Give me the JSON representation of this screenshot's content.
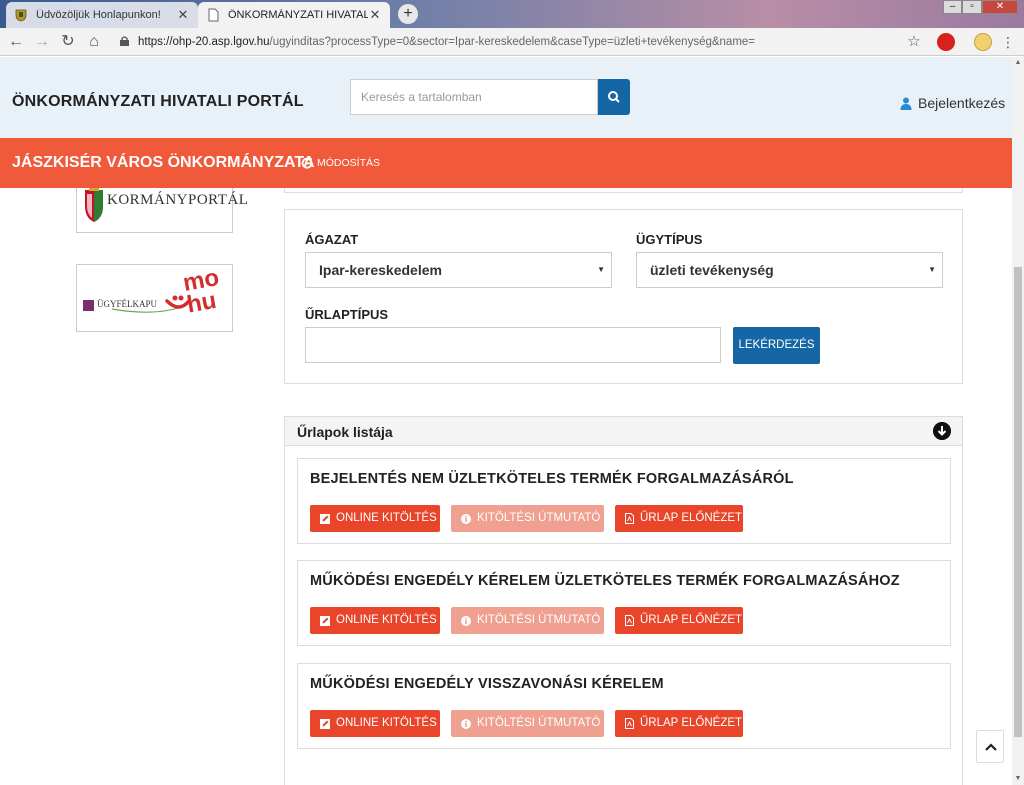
{
  "browser": {
    "tabs": [
      {
        "title": "Üdvözöljük Honlapunkon!",
        "active": false
      },
      {
        "title": "ÖNKORMÁNYZATI HIVATALI PO",
        "active": true
      }
    ],
    "url": {
      "host": "https://ohp-20.asp.lgov.hu",
      "path": "/ugyinditas?processType=0&sector=Ipar-kereskedelem&caseType=üzleti+tevékenység&name="
    }
  },
  "header": {
    "brand": "ÖNKORMÁNYZATI HIVATALI PORTÁL",
    "search_placeholder": "Keresés a tartalomban",
    "login_label": "Bejelentkezés"
  },
  "org": {
    "name": "JÁSZKISÉR VÁROS ÖNKORMÁNYZATA",
    "modify_label": "MÓDOSÍTÁS"
  },
  "sidebar": {
    "logos": [
      {
        "name": "Kormányportál",
        "text": "KORMÁNYPORTÁL"
      },
      {
        "name": "Ügyfélkapu",
        "text": "ÜGYFÉLKAPU",
        "brand": "mo hu"
      }
    ]
  },
  "filter": {
    "sector_label": "ÁGAZAT",
    "sector_value": "Ipar-kereskedelem",
    "casetype_label": "ÜGYTÍPUS",
    "casetype_value": "üzleti tevékenység",
    "formtype_label": "ŰRLAPTÍPUS",
    "formtype_value": "",
    "query_button": "LEKÉRDEZÉS"
  },
  "forms_panel": {
    "title": "Űrlapok listája",
    "buttons": {
      "online": "ONLINE KITÖLTÉS",
      "guide": "KITÖLTÉSI ÚTMUTATÓ",
      "preview": "ŰRLAP ELŐNÉZET"
    },
    "items": [
      {
        "title": "BEJELENTÉS NEM ÜZLETKÖTELES TERMÉK FORGALMAZÁSÁRÓL"
      },
      {
        "title": "MŰKÖDÉSI ENGEDÉLY KÉRELEM ÜZLETKÖTELES TERMÉK FORGALMAZÁSÁHOZ"
      },
      {
        "title": "MŰKÖDÉSI ENGEDÉLY VISSZAVONÁSI KÉRELEM"
      }
    ]
  },
  "colors": {
    "accent_orange": "#f05a3a",
    "button_red": "#e8452a",
    "button_disabled": "#f0a090",
    "primary_blue": "#1566a5",
    "header_bg": "#e8f0f8"
  },
  "icons": [
    "crest-icon",
    "page-icon",
    "close-icon",
    "plus-icon",
    "back-icon",
    "forward-icon",
    "reload-icon",
    "home-icon",
    "lock-icon",
    "star-icon",
    "search-icon",
    "user-icon",
    "refresh-icon",
    "arrow-down-circle-icon",
    "edit-icon",
    "info-icon",
    "pdf-icon",
    "chevron-up-icon"
  ]
}
